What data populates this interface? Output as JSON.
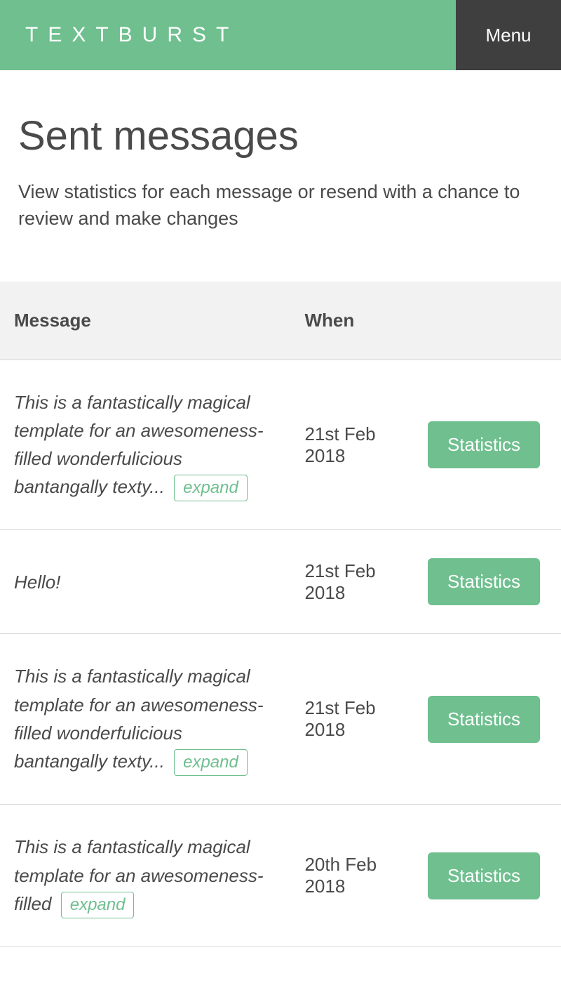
{
  "header": {
    "brand": "TEXTBURST",
    "menu_label": "Menu"
  },
  "page": {
    "title": "Sent messages",
    "subtitle": "View statistics for each message or resend with a chance to review and make changes"
  },
  "table": {
    "headers": {
      "message": "Message",
      "when": "When"
    },
    "expand_label": "expand",
    "stats_label": "Statistics",
    "rows": [
      {
        "message": "This is a fantastically magical template for an awesomeness-filled wonderfulicious bantangally texty...",
        "when": "21st Feb 2018",
        "truncated": true
      },
      {
        "message": "Hello!",
        "when": "21st Feb 2018",
        "truncated": false
      },
      {
        "message": "This is a fantastically magical template for an awesomeness-filled wonderfulicious bantangally texty...",
        "when": "21st Feb 2018",
        "truncated": true
      },
      {
        "message": "This is a fantastically magical template for an awesomeness-filled",
        "when": "20th Feb 2018",
        "truncated": true
      }
    ]
  },
  "colors": {
    "brand_green": "#6fbf8f",
    "menu_dark": "#3f3f3f"
  }
}
